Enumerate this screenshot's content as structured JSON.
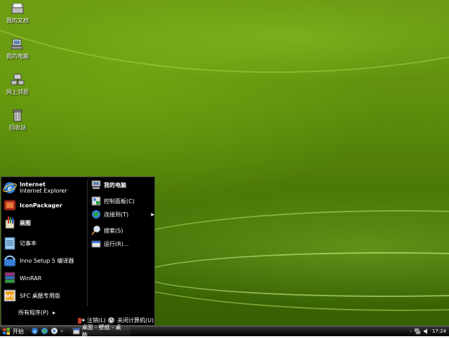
{
  "desktop": {
    "icons": [
      {
        "label": "我的文档",
        "icon": "documents-folder-icon"
      },
      {
        "label": "我的电脑",
        "icon": "computer-icon"
      },
      {
        "label": "网上邻居",
        "icon": "network-icon"
      },
      {
        "label": "回收站",
        "icon": "recycle-bin-icon"
      }
    ]
  },
  "start_menu": {
    "left_items": [
      {
        "title": "Internet",
        "subtitle": "Internet Explorer",
        "icon": "internet-explorer-icon"
      },
      {
        "title": "IconPackager",
        "icon": "iconpackager-icon"
      },
      {
        "title": "画图",
        "icon": "paint-icon"
      },
      {
        "title": "记事本",
        "icon": "notepad-icon"
      },
      {
        "title": "Inno Setup 5 编译器",
        "icon": "inno-setup-icon"
      },
      {
        "title": "WinRAR",
        "icon": "winrar-icon"
      },
      {
        "title": "SFC 桌酷专用版",
        "icon": "sfc-icon"
      }
    ],
    "right_items": [
      {
        "label": "我的电脑",
        "icon": "computer-icon"
      },
      {
        "label": "控制面板(C)",
        "icon": "control-panel-icon"
      },
      {
        "label": "连接到(T)",
        "icon": "connect-to-icon",
        "arrow": "▶"
      },
      {
        "label": "搜索(S)",
        "icon": "search-icon"
      },
      {
        "label": "运行(R)...",
        "icon": "run-icon"
      }
    ],
    "all_programs": "所有程序(P)",
    "all_programs_arrow": "▸",
    "logoff": "注销(L)",
    "shutdown": "关闭计算机(U)"
  },
  "taskbar": {
    "start_label": "开始",
    "more": "»",
    "window_title": "桌面 - 壁纸 - 桌酷...",
    "clock": "17:24"
  },
  "colors": {
    "menu_bg": "#000000",
    "wallpaper": "#5f8f0d"
  }
}
